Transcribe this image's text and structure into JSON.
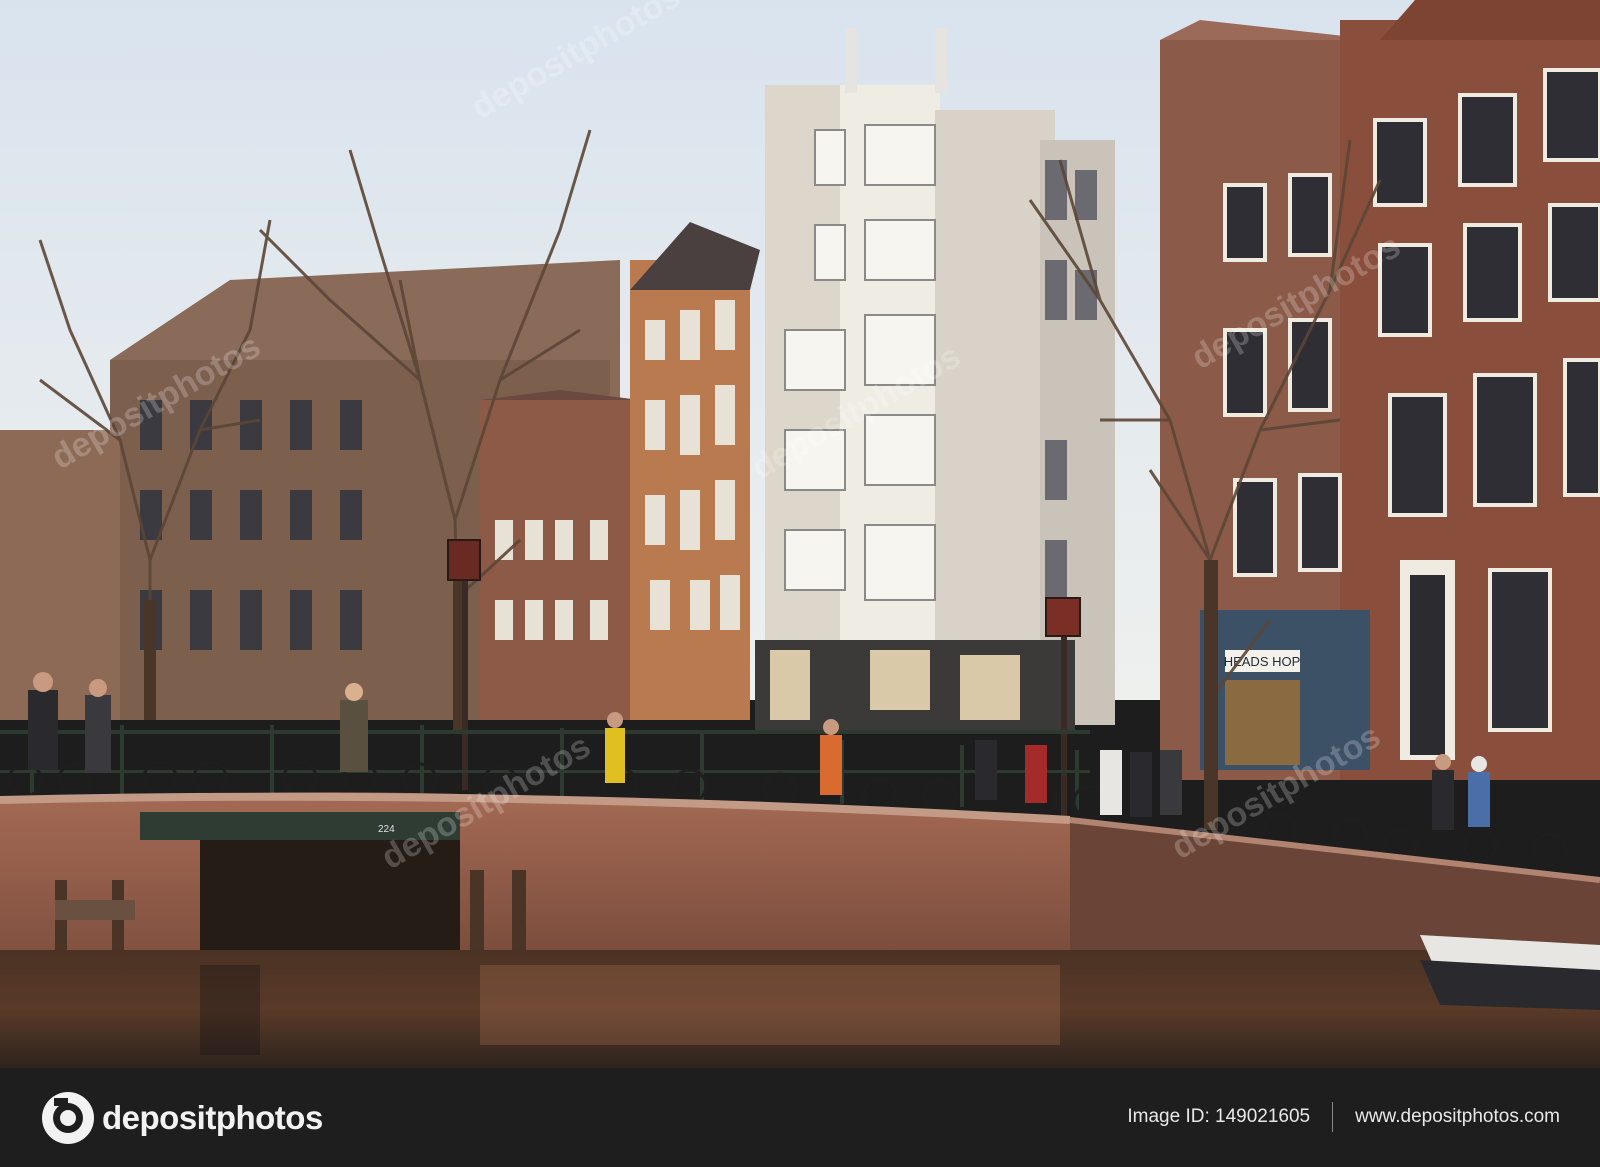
{
  "footer": {
    "logo_text": "depositphotos",
    "image_id": "Image ID: 149021605",
    "website": "www.depositphotos.com"
  },
  "scene": {
    "shop_sign": "HEADS HOP",
    "bridge_number": "224"
  },
  "watermark": "depositphotos",
  "icons": [
    "camera-aperture-icon"
  ]
}
